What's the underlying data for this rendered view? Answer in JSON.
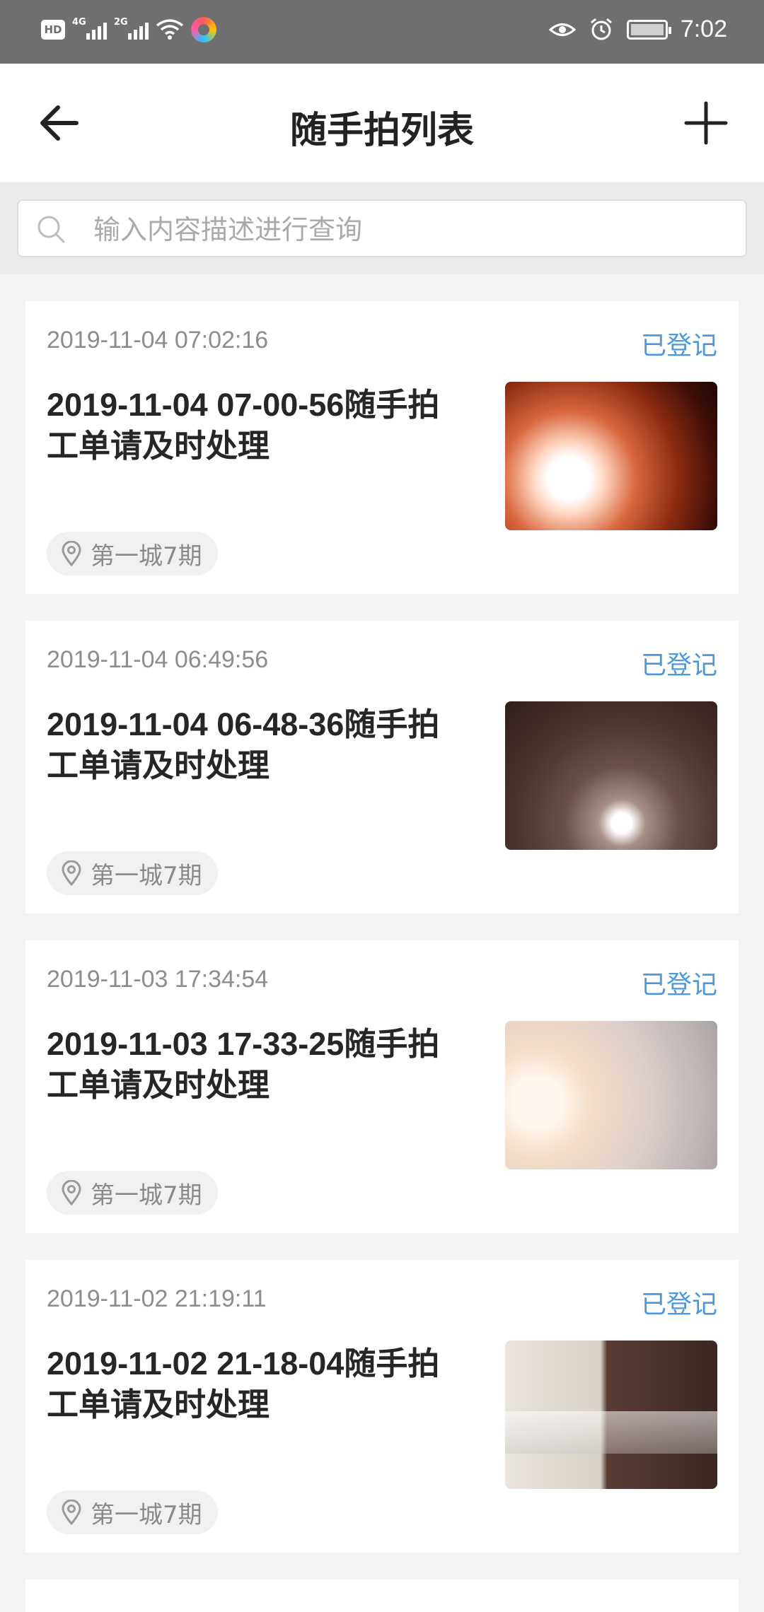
{
  "status_bar": {
    "time": "7:02",
    "hd": "HD",
    "network1": "4G",
    "network2": "2G"
  },
  "header": {
    "title": "随手拍列表"
  },
  "search": {
    "placeholder": "输入内容描述进行查询",
    "value": ""
  },
  "items": [
    {
      "time": "2019-11-04 07:02:16",
      "status": "已登记",
      "title_line1": "2019-11-04 07-00-56随手拍",
      "title_line2": "工单请及时处理",
      "location": "第一城7期"
    },
    {
      "time": "2019-11-04 06:49:56",
      "status": "已登记",
      "title_line1": "2019-11-04 06-48-36随手拍",
      "title_line2": "工单请及时处理",
      "location": "第一城7期"
    },
    {
      "time": "2019-11-03 17:34:54",
      "status": "已登记",
      "title_line1": "2019-11-03 17-33-25随手拍",
      "title_line2": "工单请及时处理",
      "location": "第一城7期"
    },
    {
      "time": "2019-11-02 21:19:11",
      "status": "已登记",
      "title_line1": "2019-11-02 21-18-04随手拍",
      "title_line2": "工单请及时处理",
      "location": "第一城7期"
    }
  ],
  "colors": {
    "status_blue": "#4a98e0",
    "status_bar": "#6f6f6f"
  },
  "icons": [
    "back-arrow-icon",
    "plus-icon",
    "search-icon",
    "location-pin-icon"
  ]
}
